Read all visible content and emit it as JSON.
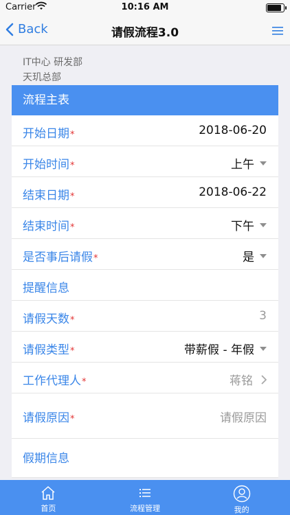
{
  "status_bar": {
    "carrier": "Carrier",
    "time": "10:16 AM",
    "battery_level": 0.9
  },
  "nav": {
    "back_label": "Back",
    "title": "请假流程3.0"
  },
  "org": {
    "department": "IT中心 研发部",
    "company": "天玑总部"
  },
  "section": {
    "title": "流程主表"
  },
  "form": {
    "start_date": {
      "label": "开始日期",
      "value": "2018-06-20"
    },
    "start_time": {
      "label": "开始时间",
      "value": "上午"
    },
    "end_date": {
      "label": "结束日期",
      "value": "2018-06-22"
    },
    "end_time": {
      "label": "结束时间",
      "value": "下午"
    },
    "post_leave": {
      "label": "是否事后请假",
      "value": "是"
    },
    "reminder": {
      "label": "提醒信息"
    },
    "days": {
      "label": "请假天数",
      "value": "3"
    },
    "leave_type": {
      "label": "请假类型",
      "value": "带薪假 - 年假"
    },
    "agent": {
      "label": "工作代理人",
      "value": "蒋铭"
    },
    "reason": {
      "label": "请假原因",
      "placeholder": "请假原因"
    },
    "holiday_info": {
      "label": "假期信息"
    },
    "required_mark": "*"
  },
  "tabs": [
    {
      "label": "首页",
      "icon": "home-icon"
    },
    {
      "label": "流程管理",
      "icon": "list-icon"
    },
    {
      "label": "我的",
      "icon": "user-icon"
    }
  ],
  "colors": {
    "accent": "#4a90f0",
    "label_blue": "#3a86e8",
    "required_red": "#e23333"
  }
}
